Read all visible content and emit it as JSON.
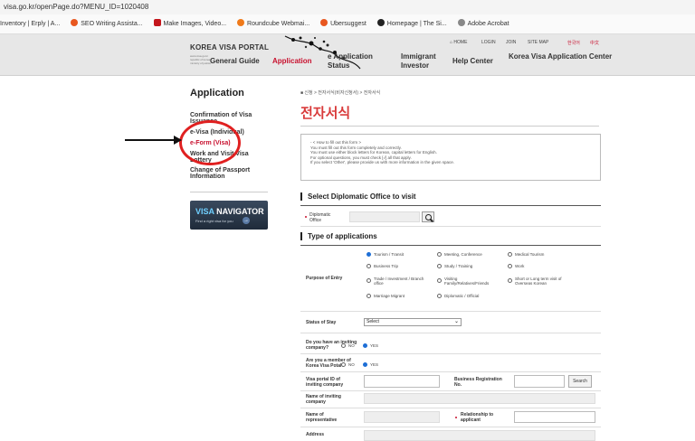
{
  "browser": {
    "url": "visa.go.kr/openPage.do?MENU_ID=1020408",
    "bookmarks": [
      {
        "label": "Inventory | Erply | A...",
        "color": "#ffffff"
      },
      {
        "label": "SEO Writing Assista...",
        "color": "#e8571f"
      },
      {
        "label": "Make Images, Video...",
        "color": "#c4161c"
      },
      {
        "label": "Roundcube Webmai...",
        "color": "#f07a1a"
      },
      {
        "label": "Ubersuggest",
        "color": "#e8571f"
      },
      {
        "label": "Homepage | The Si...",
        "color": "#222222"
      },
      {
        "label": "Adobe Acrobat",
        "color": "#888888"
      }
    ]
  },
  "header": {
    "logo": "KOREA VISA PORTAL",
    "logo_sub": "www.visa.go.kr republic of korea ministry of justice",
    "topnav": [
      "HOME",
      "LOGIN",
      "JOIN",
      "SITE MAP",
      "한국어",
      "中文"
    ],
    "nav": {
      "general_guide": "General Guide",
      "application": "Application",
      "visa_application_status": "e Application",
      "visa_application_status_sub": "Status",
      "immigrant_investor": "Immigrant",
      "immigrant_investor_2": "Investor",
      "help_center": "Help Center",
      "korea_visa_center": "Korea Visa Application Center"
    }
  },
  "sidebar": {
    "title": "Application",
    "items": [
      {
        "label": "Confirmation of Visa",
        "label2": "Issuance",
        "active": false
      },
      {
        "label": "e-Visa (Individual)",
        "label2": "",
        "active": false
      },
      {
        "label": "e-Form (Visa)",
        "label2": "",
        "active": true
      },
      {
        "label": "Work and Visit Visa",
        "label2": "Lottery",
        "active": false
      },
      {
        "label": "Change of Passport",
        "label2": "Information",
        "active": false
      }
    ],
    "visa_navigator": {
      "title_a": "VISA",
      "title_b": " NAVIGATOR",
      "subtitle": "Find a right visa for you",
      "button": "→"
    }
  },
  "main": {
    "breadcrumb": "■ 신청 > 전자서식(비자신청서) > 전자서식",
    "title": "전자서식",
    "howto": [
      "- < How to fill out this form >",
      "  You must fill out this form completely and correctly.",
      "  You must use either block letters for Korean, capital letters for English.",
      "  For optional questions, you must check [√] all that apply.",
      "  If you select 'Other', please provide us with more information in the given space."
    ],
    "section_office": "Select Diplomatic Office to visit",
    "diplomatic_office_label": "Diplomatic",
    "diplomatic_office_label2": "Office",
    "section_type": "Type of applications",
    "purpose_label": "Purpose of Entry",
    "purposes": [
      {
        "label": "Tourism / Transit",
        "checked": true
      },
      {
        "label": "Meeting, Conference",
        "checked": false
      },
      {
        "label": "Medical Tourism",
        "checked": false
      },
      {
        "label": "Business Trip",
        "checked": false
      },
      {
        "label": "Study / Training",
        "checked": false
      },
      {
        "label": "Work",
        "checked": false
      },
      {
        "label": "Trade / Investment / Branch",
        "label2": "office",
        "checked": false
      },
      {
        "label": "Visiting",
        "label2": "Family/Relatives/Friends",
        "checked": false
      },
      {
        "label": "Short or Long term visit of",
        "label2": "Overseas Korean",
        "checked": false
      },
      {
        "label": "Marriage Migrant",
        "checked": false
      },
      {
        "label": "Diplomatic / Official",
        "checked": false
      }
    ],
    "status_of_stay_label": "Status of Stay",
    "status_of_stay_value": "Select",
    "inviting_label": "Do you have an inviting",
    "inviting_label2": "company?",
    "member_label": "Are you a member of",
    "member_label2": "Korea Visa Potal?",
    "no": "NO",
    "yes": "YES",
    "portal_id_label": "Visa portal ID of",
    "portal_id_label2": "inviting company",
    "biz_reg_label": "Business Registration",
    "biz_reg_label2": "No.",
    "search_button": "Search",
    "inviting_name_label": "Name of inviting",
    "inviting_name_label2": "company",
    "representative_label": "Name of",
    "representative_label2": "representative",
    "relationship_label": "Relationship to",
    "relationship_label2": "applicant",
    "address_label": "Address"
  }
}
